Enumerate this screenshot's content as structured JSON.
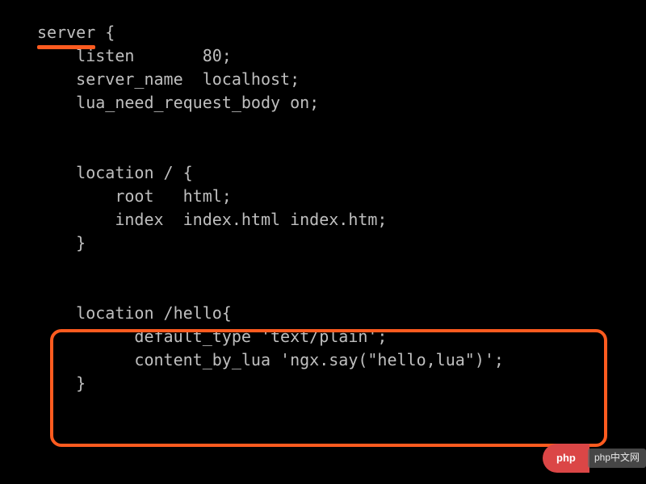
{
  "code": {
    "line1_keyword": "server",
    "line1_rest": " {",
    "line2": "    listen       80;",
    "line3": "    server_name  localhost;",
    "line4": "    lua_need_request_body on;",
    "line5": "",
    "line6": "",
    "line7": "    location / {",
    "line8": "        root   html;",
    "line9": "        index  index.html index.htm;",
    "line10": "    }",
    "line11": "",
    "line12": "",
    "line13": "    location /hello{",
    "line14": "          default_type 'text/plain';",
    "line15": "          content_by_lua 'ngx.say(\"hello,lua\")';",
    "line16": "    }"
  },
  "watermark": {
    "logo": "php",
    "text": "php中文网"
  }
}
